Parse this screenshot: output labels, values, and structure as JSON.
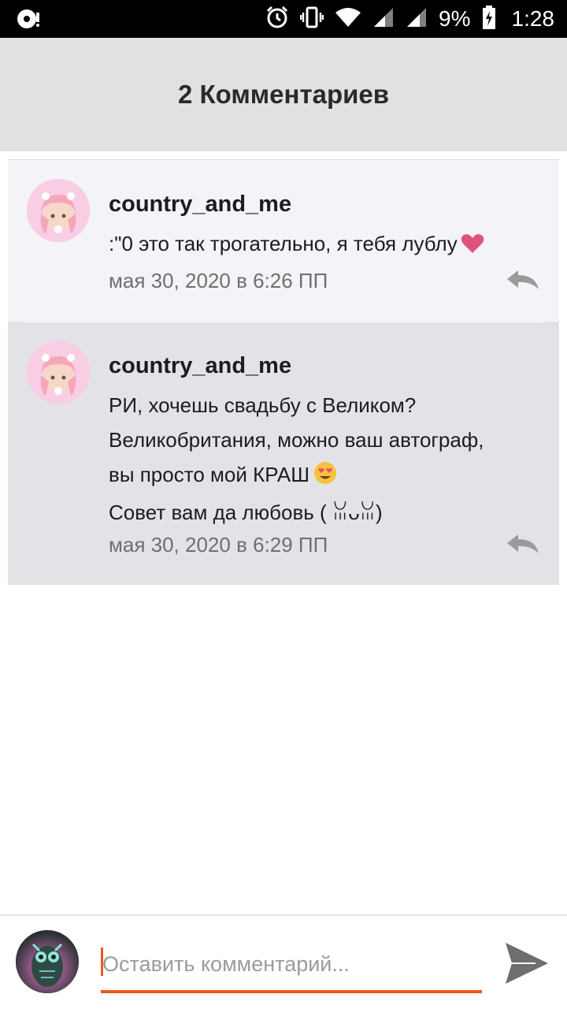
{
  "status_bar": {
    "battery": "9%",
    "time": "1:28",
    "icons": [
      "disc-icon",
      "alarm-icon",
      "vibrate-icon",
      "wifi-icon",
      "signal-icon",
      "signal-icon-2",
      "battery-charging-icon"
    ]
  },
  "header": {
    "title": "2 Комментариев"
  },
  "comments": [
    {
      "username": "country_and_me",
      "lines": [
        ":\"0 это так трогательно, я тебя лублу"
      ],
      "emoji": "heart-icon",
      "time": "мая 30, 2020 в 6:26 ПП"
    },
    {
      "username": "country_and_me",
      "lines": [
        "РИ, хочешь свадьбу с Великом?",
        "Великобритания, можно ваш автограф,",
        "вы просто мой КРАШ",
        "Совет вам да любовь ( ꈍᴗꈍ)"
      ],
      "emoji": "heart-eyes-emoji-icon",
      "time": "мая 30, 2020 в 6:29 ПП"
    }
  ],
  "composer": {
    "placeholder": "Оставить комментарий..."
  },
  "colors": {
    "accent": "#ec5a1c",
    "header_bg": "#e1e1e1",
    "comment_bg_1": "#f4f3f7",
    "comment_bg_2": "#e3e2e7"
  }
}
